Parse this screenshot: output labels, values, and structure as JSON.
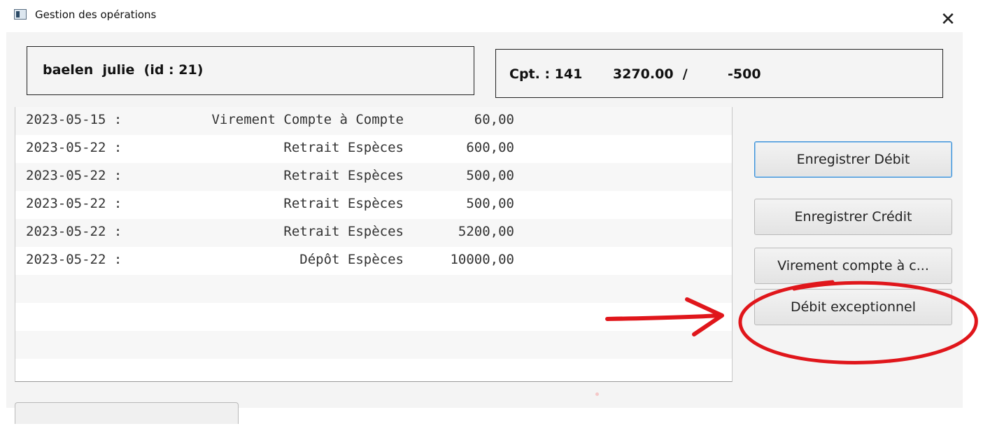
{
  "window": {
    "title": "Gestion des opérations",
    "close_symbol": "✕"
  },
  "client": {
    "label": "baelen  julie  (id : 21)"
  },
  "account": {
    "account_label": "Cpt. : 141",
    "balance": "3270.00  /",
    "overdraft": "-500"
  },
  "operations": [
    {
      "date": "2023-05-15 :",
      "label": "Virement Compte à Compte",
      "amount": "60,00"
    },
    {
      "date": "2023-05-22 :",
      "label": "Retrait Espèces",
      "amount": "600,00"
    },
    {
      "date": "2023-05-22 :",
      "label": "Retrait Espèces",
      "amount": "500,00"
    },
    {
      "date": "2023-05-22 :",
      "label": "Retrait Espèces",
      "amount": "500,00"
    },
    {
      "date": "2023-05-22 :",
      "label": "Retrait Espèces",
      "amount": "5200,00"
    },
    {
      "date": "2023-05-22 :",
      "label": "Dépôt Espèces",
      "amount": "10000,00"
    }
  ],
  "buttons": {
    "debit": "Enregistrer Débit",
    "credit": "Enregistrer Crédit",
    "transfer": "Virement compte à c...",
    "exceptional_debit": "Débit exceptionnel"
  },
  "annotation_color": "#e0161b"
}
